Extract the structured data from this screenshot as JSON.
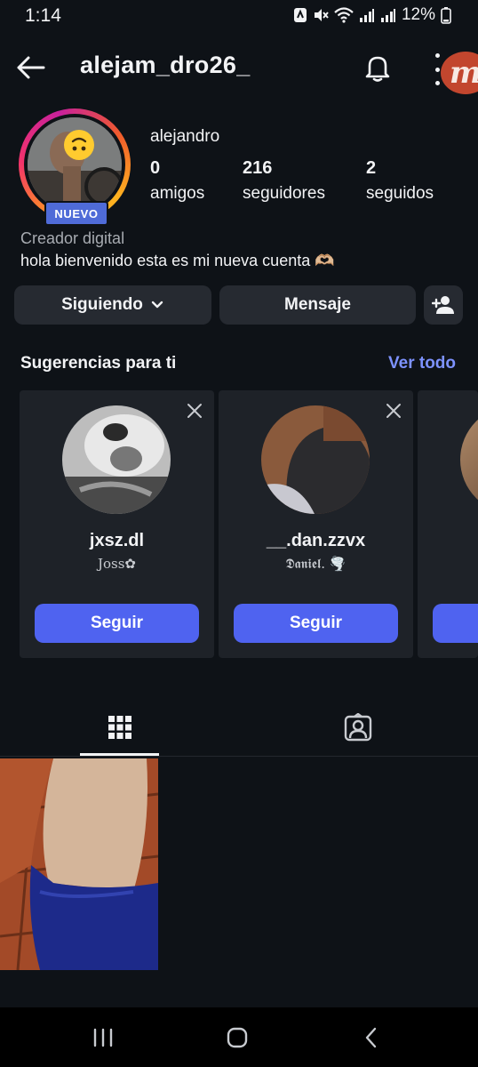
{
  "status_bar": {
    "time": "1:14",
    "battery": "12%"
  },
  "header": {
    "username": "alejam_dro26_",
    "brand_badge": "m"
  },
  "profile": {
    "badge": "NUEVO",
    "display_name": "alejandro",
    "stats": [
      {
        "value": "0",
        "label": "amigos"
      },
      {
        "value": "216",
        "label": "seguidores"
      },
      {
        "value": "2",
        "label": "seguidos"
      }
    ],
    "category": "Creador digital",
    "bio": "hola bienvenido esta es mi nueva cuenta 🫶🏼"
  },
  "actions": {
    "following_label": "Siguiendo",
    "message_label": "Mensaje"
  },
  "suggestions": {
    "title": "Sugerencias para ti",
    "see_all": "Ver todo",
    "cards": [
      {
        "username": "jxsz.dl",
        "name": "Joss✿",
        "follow_label": "Seguir"
      },
      {
        "username": "__.dan.zzvx",
        "name": "𝕯𝖆𝖓𝖎𝖊𝖑. 🌪️",
        "follow_label": "Seguir"
      }
    ]
  },
  "icons": {
    "back": "arrow-left-icon",
    "bell": "bell-icon",
    "more": "more-vertical-icon",
    "add_person": "person-add-icon",
    "grid": "grid-icon",
    "tagged": "tagged-person-icon"
  },
  "colors": {
    "background": "#0e1217",
    "accent_blue": "#4f63f0",
    "link_blue": "#7d92ff",
    "badge_blue": "#4f6bd8",
    "button_gray": "#262a31",
    "card_gray": "#1e2228"
  }
}
